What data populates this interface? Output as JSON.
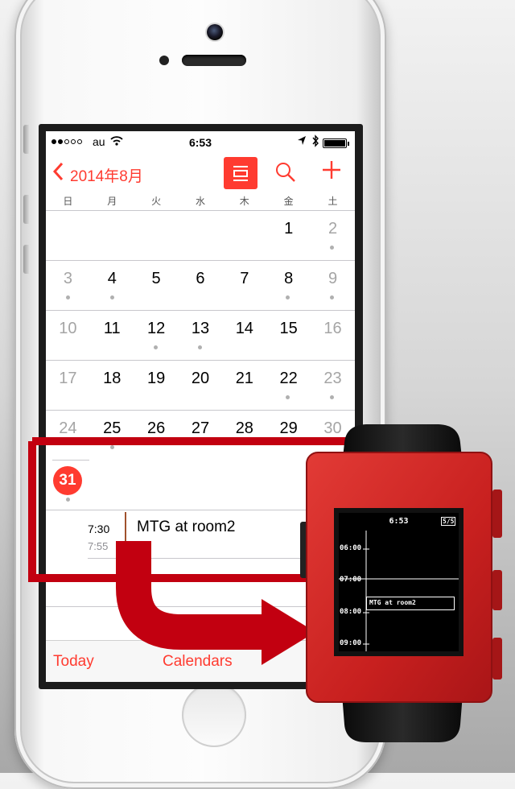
{
  "statusbar": {
    "carrier": "au",
    "time": "6:53"
  },
  "navbar": {
    "month": "2014年8月"
  },
  "weekdays": [
    "日",
    "月",
    "火",
    "水",
    "木",
    "金",
    "土"
  ],
  "weeks": [
    [
      "",
      "",
      "",
      "",
      "",
      "1",
      "2"
    ],
    [
      "3",
      "4",
      "5",
      "6",
      "7",
      "8",
      "9"
    ],
    [
      "10",
      "11",
      "12",
      "13",
      "14",
      "15",
      "16"
    ],
    [
      "17",
      "18",
      "19",
      "20",
      "21",
      "22",
      "23"
    ],
    [
      "24",
      "25",
      "26",
      "27",
      "28",
      "29",
      "30"
    ]
  ],
  "selected_date": "31",
  "event": {
    "start": "7:30",
    "end": "7:55",
    "title": "MTG at room2"
  },
  "tabbar": {
    "today": "Today",
    "calendars": "Calendars"
  },
  "pebble": {
    "time": "6:53",
    "battery": "5/5",
    "hours": [
      "06:00",
      "07:00",
      "08:00",
      "09:00"
    ],
    "event_title": "MTG at room2"
  },
  "colors": {
    "accent": "#ff3b30",
    "pebble_body": "#cc2a28",
    "arrow": "#c20010",
    "event_bar": "#a0522d"
  }
}
